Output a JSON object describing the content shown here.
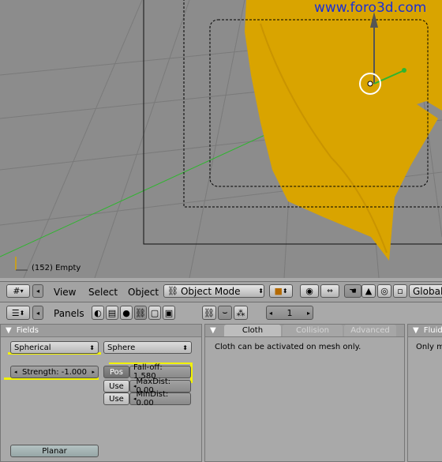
{
  "viewport": {
    "watermark": "www.foro3d.com",
    "object_label": "(152) Empty"
  },
  "header": {
    "menus": [
      "View",
      "Select",
      "Object"
    ],
    "mode": "Object Mode",
    "layer_value": "1",
    "orientation": "Global"
  },
  "panelbar": {
    "panels_label": "Panels",
    "frame_value": "1"
  },
  "fields_panel": {
    "title": "Fields",
    "field_type": "Spherical",
    "shape": "Sphere",
    "strength_label": "Strength: -1.000",
    "pos_label": "Pos",
    "falloff_label": "Fall-off: 1.580",
    "use_label_1": "Use",
    "maxdist_label": "MaxDist: 0.00",
    "use_label_2": "Use",
    "mindist_label": "MinDist: 0.00",
    "planar_label": "Planar"
  },
  "cloth_panel": {
    "tabs": [
      "Cloth",
      "Collision",
      "Advanced"
    ],
    "message": "Cloth can be activated on mesh only."
  },
  "fluid_panel": {
    "title": "Fluid",
    "message": "Only me"
  },
  "colors": {
    "mesh_yellow": "#d9a400",
    "highlight": "#f2f200",
    "axis_green": "#2fb52f"
  }
}
